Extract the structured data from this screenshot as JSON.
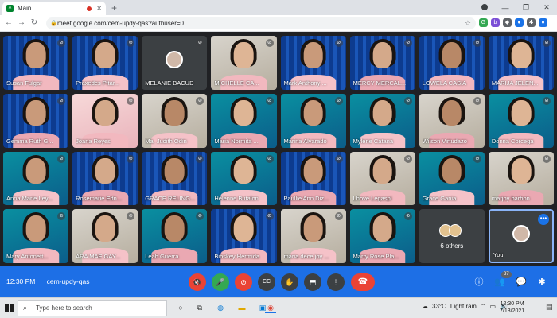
{
  "browser": {
    "tab_title": "Main",
    "tab_close": "✕",
    "new_tab": "+",
    "url": "meet.google.com/cem-updy-qas?authuser=0",
    "window_controls": [
      "—",
      "❐",
      "✕"
    ]
  },
  "participants": [
    {
      "name": "Susan Fulgar",
      "bg": "bg-curtain"
    },
    {
      "name": "Praxedes Pitar...",
      "bg": "bg-curtain"
    },
    {
      "name": "MELANIE BACUD",
      "bg": "bg-dark",
      "avatar": true
    },
    {
      "name": "MICHELLE CA...",
      "bg": "bg-room"
    },
    {
      "name": "Mark Anthony ...",
      "bg": "bg-curtain"
    },
    {
      "name": "MERCY MERCAL...",
      "bg": "bg-curtain"
    },
    {
      "name": "LOWELA CASIA",
      "bg": "bg-curtain"
    },
    {
      "name": "MARIJA JELEN...",
      "bg": "bg-curtain"
    },
    {
      "name": "Gemma Ruth G...",
      "bg": "bg-curtain"
    },
    {
      "name": "Joana Reyes",
      "bg": "bg-pink"
    },
    {
      "name": "Ma. Judith Odin",
      "bg": "bg-room"
    },
    {
      "name": "Maria Normita ...",
      "bg": "bg-teal"
    },
    {
      "name": "Marina Alvarado",
      "bg": "bg-teal"
    },
    {
      "name": "Mylene Catana",
      "bg": "bg-teal"
    },
    {
      "name": "Wilson Virtudazo",
      "bg": "bg-room"
    },
    {
      "name": "Donna Corcega",
      "bg": "bg-teal"
    },
    {
      "name": "Anna Marie Ley...",
      "bg": "bg-teal"
    },
    {
      "name": "Rosemarie Edn...",
      "bg": "bg-curtain"
    },
    {
      "name": "GRACE RELING...",
      "bg": "bg-curtain"
    },
    {
      "name": "Helenne Butalon",
      "bg": "bg-teal"
    },
    {
      "name": "Paullie Ann Diz...",
      "bg": "bg-curtain"
    },
    {
      "name": "Lhove Legaspi",
      "bg": "bg-room"
    },
    {
      "name": "Grace Gania",
      "bg": "bg-teal"
    },
    {
      "name": "marjoy barbon",
      "bg": "bg-room"
    },
    {
      "name": "Mary Antonett...",
      "bg": "bg-teal"
    },
    {
      "name": "ARA MAE GAY...",
      "bg": "bg-room"
    },
    {
      "name": "Leah Guerra",
      "bg": "bg-teal"
    },
    {
      "name": "Bibskey Hermida",
      "bg": "bg-curtain"
    },
    {
      "name": "maria dece joy ...",
      "bg": "bg-room"
    },
    {
      "name": "Marry Rose Pla...",
      "bg": "bg-teal"
    }
  ],
  "others_tile": {
    "label": "6 others"
  },
  "self_tile": {
    "label": "You",
    "menu": "•••"
  },
  "meeting": {
    "time": "12:30 PM",
    "separator": "|",
    "code": "cem-updy-qas",
    "participant_count": "37"
  },
  "controls": {
    "speaker": "🔇",
    "mic": "🎤",
    "camera": "⊘",
    "captions": "CC",
    "raise_hand": "✋",
    "present": "⬒",
    "more": "⋮",
    "end_call": "☎",
    "info": "ⓘ",
    "people": "👥",
    "chat": "💬",
    "activities": "✱"
  },
  "taskbar": {
    "search_placeholder": "Type here to search",
    "weather_temp": "33°C",
    "weather_text": "Light rain",
    "time": "12:30 PM",
    "date": "7/13/2021"
  }
}
